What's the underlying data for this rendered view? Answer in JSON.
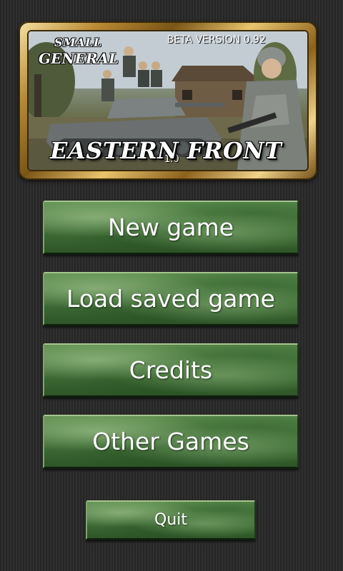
{
  "banner": {
    "small_label": "SMALL",
    "general_label": "GENERAL",
    "beta_version": "BETA VERSION 0.92",
    "title": "EASTERN FRONT",
    "sub_version": "1.0"
  },
  "menu": {
    "new_game": "New game",
    "load_saved_game": "Load saved game",
    "credits": "Credits",
    "other_games": "Other Games",
    "quit": "Quit"
  },
  "colors": {
    "background": "#2a2a2a",
    "button_green": "#4a7a40",
    "frame_gold": "#c9a24a",
    "text": "#ffffff"
  }
}
